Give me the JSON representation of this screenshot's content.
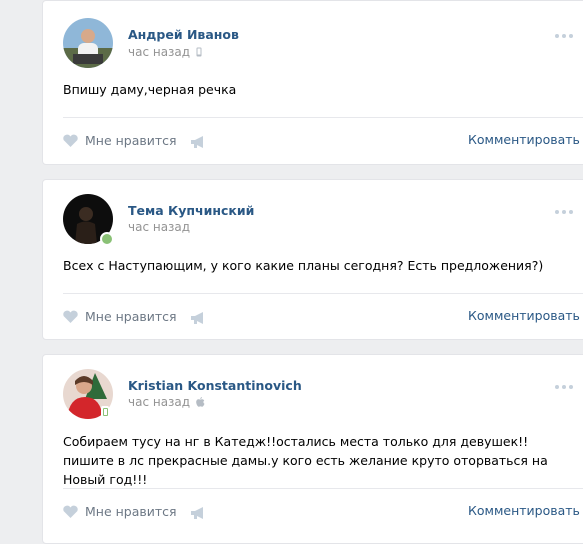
{
  "posts": [
    {
      "author": "Андрей Иванов",
      "time": "час назад",
      "device_icon": "phone-icon",
      "text": "Впишу даму,черная речка",
      "like_label": "Мне нравится",
      "comment_label": "Комментировать"
    },
    {
      "author": "Тема Купчинский",
      "time": "час назад",
      "device_icon": "none",
      "text": "Всех с Наступающим, у кого какие планы сегодня? Есть предложения?)",
      "like_label": "Мне нравится",
      "comment_label": "Комментировать"
    },
    {
      "author": "Kristian Konstantinovich",
      "time": "час назад",
      "device_icon": "apple-icon",
      "text": "Собираем тусу на нг в Катедж!!остались места только для девушек!!пишите в лс прекрасные дамы.у кого есть желание круто оторваться на Новый год!!!",
      "like_label": "Мне нравится",
      "comment_label": "Комментировать"
    }
  ],
  "colors": {
    "accent": "#2a5885",
    "muted": "#939393",
    "online": "#8ac176",
    "background": "#edeef0"
  }
}
